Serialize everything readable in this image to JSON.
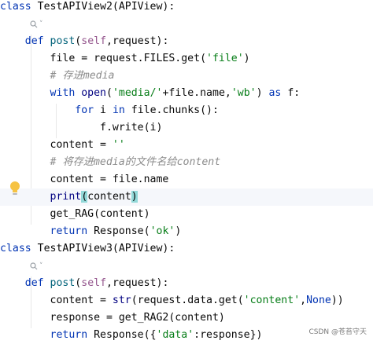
{
  "editor": {
    "language": "python",
    "colors": {
      "keyword": "#0033b3",
      "builtin": "#000080",
      "self": "#94558d",
      "string": "#067d17",
      "comment": "#8c8c8c",
      "function_def": "#00627a",
      "paren_match_bg": "#93d9d9",
      "current_line_bg": "#f5f7fb"
    },
    "usage_hint_icon": "usages-icon",
    "caret_line_icon": "lightbulb-icon",
    "lines": [
      {
        "segs": [
          {
            "t": "class ",
            "c": "kw"
          },
          {
            "t": "TestAPIView2(APIView):"
          }
        ]
      },
      {
        "hint": "⌟"
      },
      {
        "segs": [
          {
            "t": "    "
          },
          {
            "t": "def ",
            "c": "kw"
          },
          {
            "t": "post",
            "c": "fn"
          },
          {
            "t": "("
          },
          {
            "t": "self",
            "c": "self"
          },
          {
            "t": ",request):"
          }
        ]
      },
      {
        "segs": [
          {
            "t": "        file = request.FILES.get("
          },
          {
            "t": "'file'",
            "c": "str"
          },
          {
            "t": ")"
          }
        ]
      },
      {
        "segs": [
          {
            "t": "        "
          },
          {
            "t": "# 存进media",
            "c": "cmt"
          }
        ]
      },
      {
        "segs": [
          {
            "t": "        "
          },
          {
            "t": "with ",
            "c": "kw"
          },
          {
            "t": "open",
            "c": "bi"
          },
          {
            "t": "("
          },
          {
            "t": "'media/'",
            "c": "str"
          },
          {
            "t": "+file.name,"
          },
          {
            "t": "'wb'",
            "c": "str"
          },
          {
            "t": ") "
          },
          {
            "t": "as ",
            "c": "kw"
          },
          {
            "t": "f:"
          }
        ]
      },
      {
        "segs": [
          {
            "t": "            "
          },
          {
            "t": "for ",
            "c": "kw"
          },
          {
            "t": "i "
          },
          {
            "t": "in ",
            "c": "kw"
          },
          {
            "t": "file.chunks():"
          }
        ]
      },
      {
        "segs": [
          {
            "t": "                f.write(i)"
          }
        ]
      },
      {
        "segs": [
          {
            "t": "        content = "
          },
          {
            "t": "''",
            "c": "str"
          }
        ]
      },
      {
        "segs": [
          {
            "t": "        "
          },
          {
            "t": "# 将存进media的文件名给content",
            "c": "cmt"
          }
        ]
      },
      {
        "segs": [
          {
            "t": "        content = file.name"
          }
        ]
      },
      {
        "highlight": true,
        "segs": [
          {
            "t": "        "
          },
          {
            "t": "print",
            "c": "bi"
          },
          {
            "t": "(",
            "c": "ph"
          },
          {
            "t": "content"
          },
          {
            "t": ")",
            "c": "ph"
          }
        ]
      },
      {
        "segs": [
          {
            "t": "        get_RAG(content)"
          }
        ]
      },
      {
        "segs": [
          {
            "t": "        "
          },
          {
            "t": "return ",
            "c": "kw"
          },
          {
            "t": "Response("
          },
          {
            "t": "'ok'",
            "c": "str"
          },
          {
            "t": ")"
          }
        ]
      },
      {
        "segs": [
          {
            "t": "class ",
            "c": "kw"
          },
          {
            "t": "TestAPIView3(APIView):"
          }
        ]
      },
      {
        "hint": "⌟"
      },
      {
        "segs": [
          {
            "t": "    "
          },
          {
            "t": "def ",
            "c": "kw"
          },
          {
            "t": "post",
            "c": "fn"
          },
          {
            "t": "("
          },
          {
            "t": "self",
            "c": "self"
          },
          {
            "t": ",request):"
          }
        ]
      },
      {
        "segs": [
          {
            "t": "        content = "
          },
          {
            "t": "str",
            "c": "bi"
          },
          {
            "t": "(request.data.get("
          },
          {
            "t": "'content'",
            "c": "str"
          },
          {
            "t": ","
          },
          {
            "t": "None",
            "c": "kw"
          },
          {
            "t": "))"
          }
        ]
      },
      {
        "segs": [
          {
            "t": "        response = get_RAG2(content)"
          }
        ]
      },
      {
        "segs": [
          {
            "t": "        "
          },
          {
            "t": "return ",
            "c": "kw"
          },
          {
            "t": "Response({"
          },
          {
            "t": "'data'",
            "c": "str"
          },
          {
            "t": ":response})"
          }
        ]
      }
    ]
  },
  "watermark": "CSDN @苍苔守天"
}
